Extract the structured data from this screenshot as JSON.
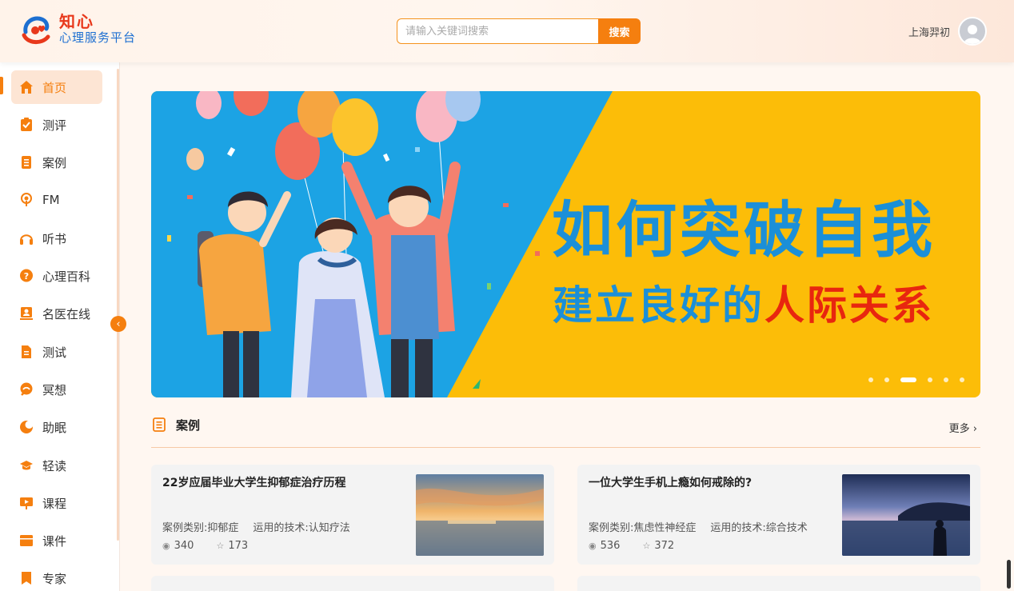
{
  "header": {
    "logo_title": "知心",
    "logo_subtitle": "心理服务平台",
    "search_placeholder": "请输入关键词搜索",
    "search_button": "搜索",
    "user_name": "上海羿初"
  },
  "sidebar": {
    "items": [
      {
        "label": "首页",
        "icon": "home-icon",
        "active": true
      },
      {
        "label": "测评",
        "icon": "clipboard-check-icon"
      },
      {
        "label": "案例",
        "icon": "document-list-icon"
      },
      {
        "label": "FM",
        "icon": "podcast-icon"
      },
      {
        "label": "听书",
        "icon": "headphones-icon"
      },
      {
        "label": "心理百科",
        "icon": "question-bubble-icon"
      },
      {
        "label": "名医在线",
        "icon": "doctor-icon"
      },
      {
        "label": "测试",
        "icon": "test-document-icon"
      },
      {
        "label": "冥想",
        "icon": "meditation-icon"
      },
      {
        "label": "助眠",
        "icon": "moon-icon"
      },
      {
        "label": "轻读",
        "icon": "graduation-cap-icon"
      },
      {
        "label": "课程",
        "icon": "presentation-icon"
      },
      {
        "label": "课件",
        "icon": "courseware-icon"
      },
      {
        "label": "专家",
        "icon": "bookmark-icon"
      }
    ],
    "collapse_icon": "chevron-left-icon"
  },
  "banner": {
    "line1": "如何突破自我",
    "line2_prefix": "建立良好的",
    "line2_highlight": "人际关系",
    "slide_count": 6,
    "active_slide": 3,
    "colors": {
      "left_bg": "#1ca3e4",
      "right_bg": "#fcbd08",
      "text_blue": "#1b8fd8",
      "text_red": "#e8260f"
    }
  },
  "section": {
    "title": "案例",
    "more": "更多 ›"
  },
  "cases": [
    {
      "title": "22岁应届毕业大学生抑郁症治疗历程",
      "category": "案例类别:抑郁症",
      "technique": "运用的技术:认知疗法",
      "views": "340",
      "favorites": "173"
    },
    {
      "title": "一位大学生手机上瘾如何戒除的?",
      "category": "案例类别:焦虑性神经症",
      "technique": "运用的技术:综合技术",
      "views": "536",
      "favorites": "372"
    }
  ],
  "theme": {
    "accent": "#f57f0f",
    "active_bg": "#fde5d4"
  }
}
